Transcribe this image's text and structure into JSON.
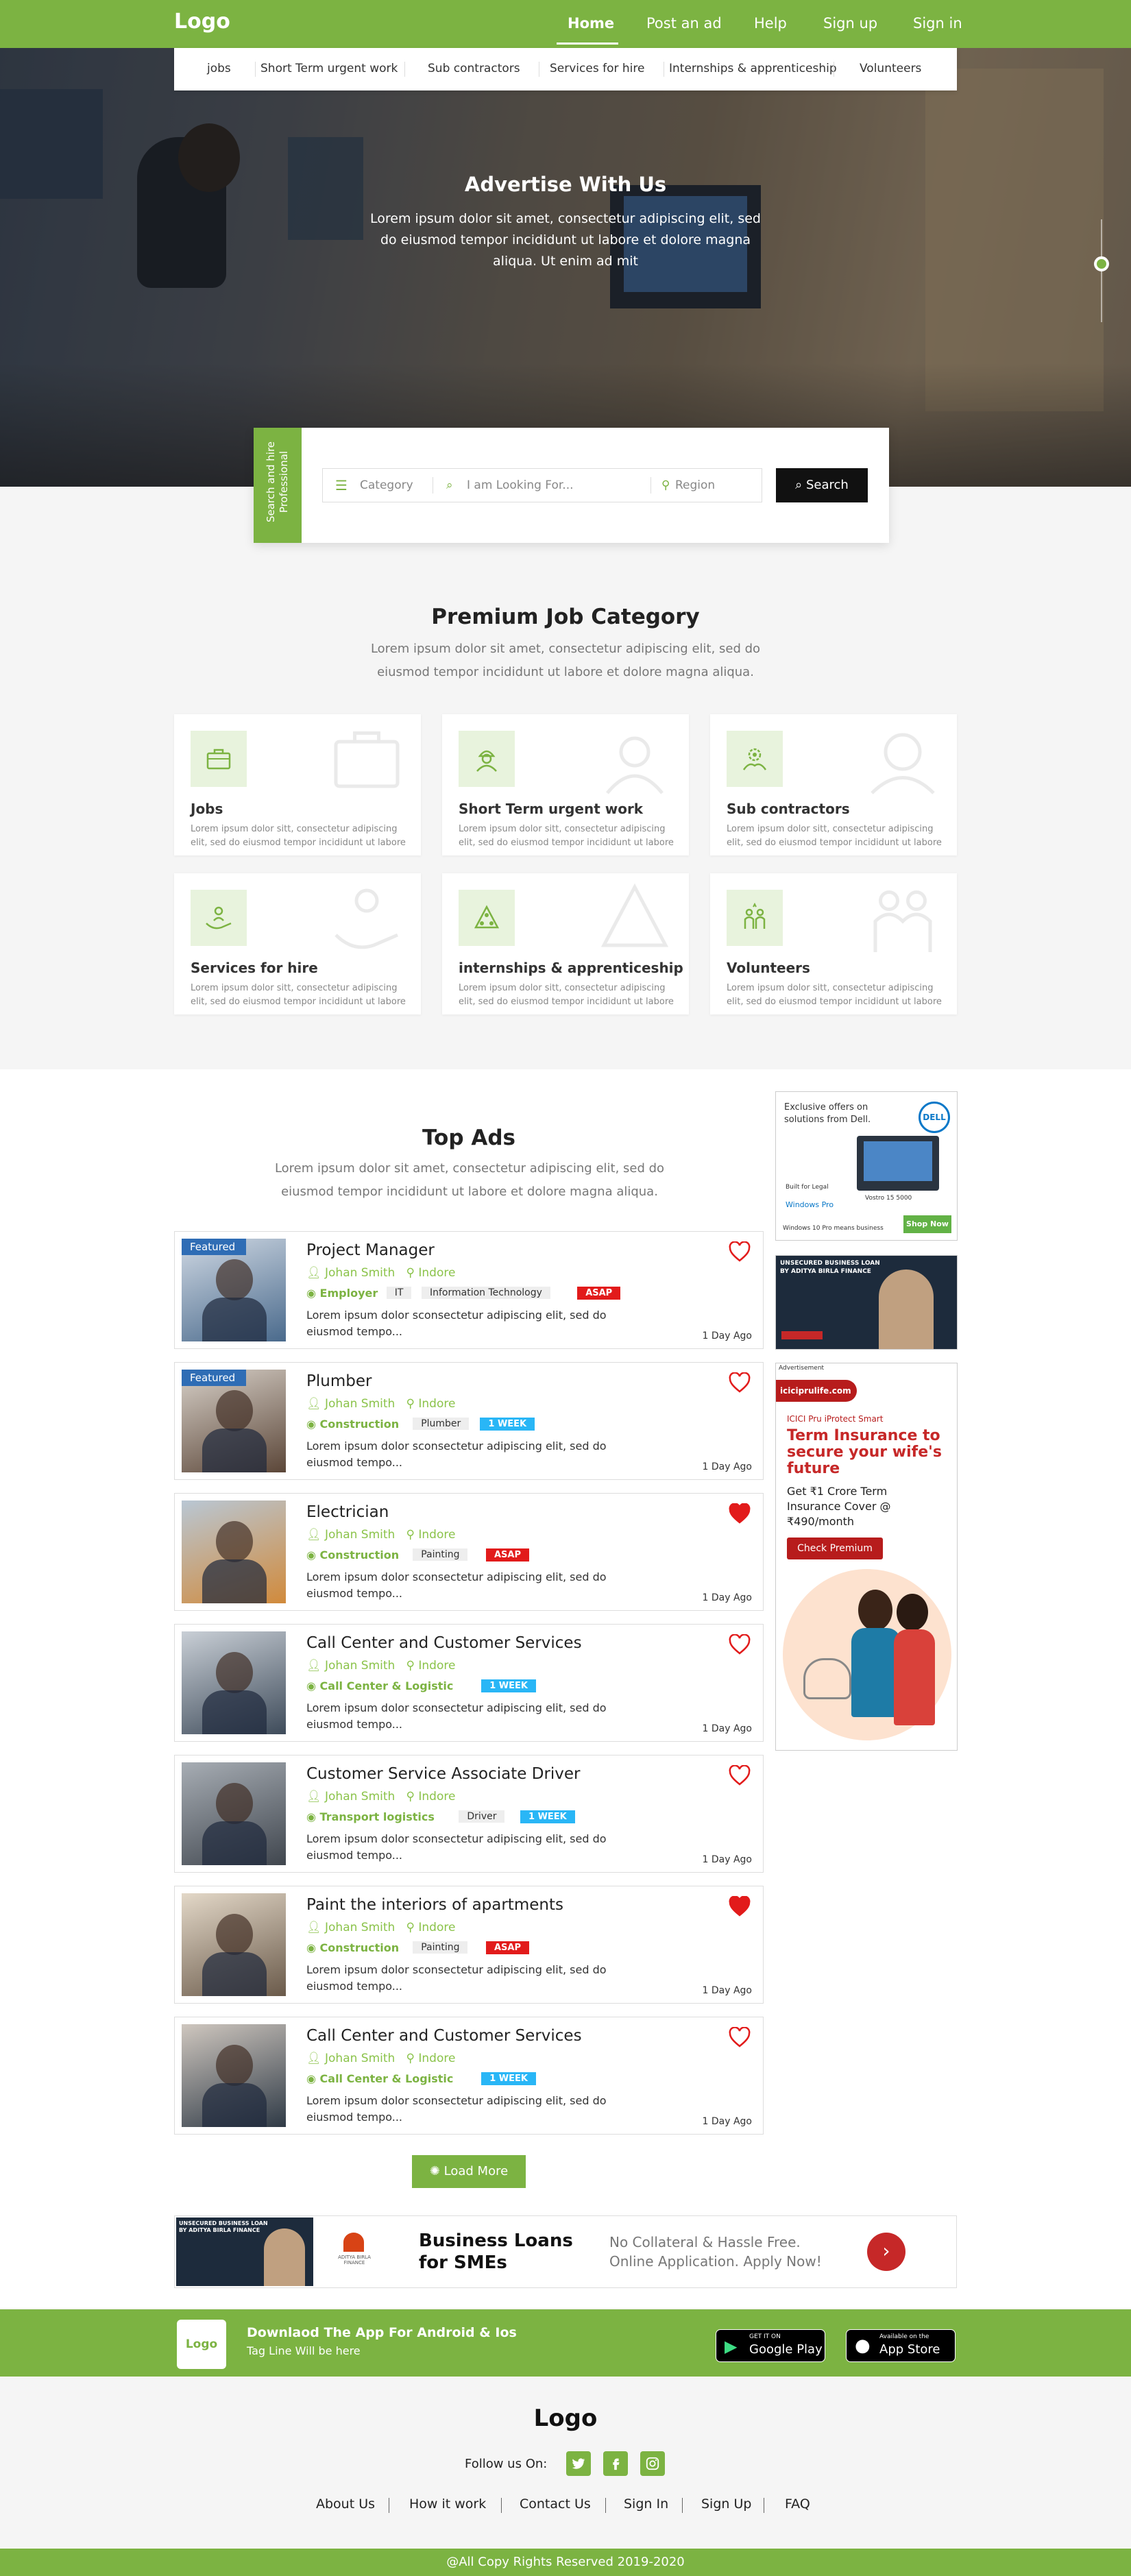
{
  "header": {
    "logo": "Logo",
    "nav": [
      "Home",
      "Post an ad",
      "Help",
      "Sign up",
      "Sign in"
    ]
  },
  "subnav": [
    "jobs",
    "Short Term urgent work",
    "Sub contractors",
    "Services for hire",
    "Internships & apprenticeship",
    "Volunteers"
  ],
  "hero": {
    "title": "Advertise With Us",
    "text": "Lorem ipsum dolor sit amet, consectetur adipiscing elit, sed do eiusmod tempor incididunt ut labore et dolore magna aliqua. Ut enim ad mit"
  },
  "search": {
    "tab_label": "Search and hire Professional",
    "category": "Category",
    "looking_placeholder": "I am Looking For...",
    "region": "Region",
    "button": "Search"
  },
  "categories": {
    "title": "Premium Job Category",
    "description": "Lorem ipsum dolor sit amet, consectetur adipiscing elit, sed do eiusmod tempor incididunt ut labore et dolore magna aliqua.",
    "items": [
      {
        "title": "Jobs",
        "text": "Lorem ipsum dolor sitt, consectetur adipiscing elit, sed do eiusmod tempor incididunt ut labore",
        "icon": "briefcase-icon"
      },
      {
        "title": "Short Term urgent work",
        "text": "Lorem ipsum dolor sitt, consectetur adipiscing elit, sed do eiusmod tempor incididunt ut labore",
        "icon": "worker-icon"
      },
      {
        "title": "Sub contractors",
        "text": "Lorem ipsum dolor sitt, consectetur adipiscing elit, sed do eiusmod tempor incididunt ut labore",
        "icon": "gear-people-icon"
      },
      {
        "title": "Services for hire",
        "text": "Lorem ipsum dolor sitt, consectetur adipiscing elit, sed do eiusmod tempor incididunt ut labore",
        "icon": "hand-person-icon"
      },
      {
        "title": "internships & apprenticeship",
        "text": "Lorem ipsum dolor sitt, consectetur adipiscing elit, sed do eiusmod tempor incididunt ut labore",
        "icon": "team-pyramid-icon"
      },
      {
        "title": "Volunteers",
        "text": "Lorem ipsum dolor sitt, consectetur adipiscing elit, sed do eiusmod tempor incididunt ut labore",
        "icon": "volunteers-icon"
      }
    ]
  },
  "top_ads": {
    "title": "Top Ads",
    "description": "Lorem ipsum dolor sit amet, consectetur adipiscing elit, sed do eiusmod tempor incididunt ut labore et dolore magna aliqua.",
    "featured_label": "Featured",
    "items": [
      {
        "title": "Project Manager",
        "user": "Johan Smith",
        "location": "Indore",
        "category": "Employer",
        "tags": [
          "IT",
          "Information Technology"
        ],
        "badge": "ASAP",
        "desc": "Lorem ipsum dolor sconsectetur adipiscing elit, sed do eiusmod tempo...",
        "time": "1 Day Ago",
        "featured": true,
        "favorited": false
      },
      {
        "title": "Plumber",
        "user": "Johan Smith",
        "location": "Indore",
        "category": "Construction",
        "tags": [
          "Plumber"
        ],
        "badge": "1 WEEK",
        "desc": "Lorem ipsum dolor sconsectetur adipiscing elit, sed do eiusmod tempo...",
        "time": "1 Day Ago",
        "featured": true,
        "favorited": false
      },
      {
        "title": "Electrician",
        "user": "Johan Smith",
        "location": "Indore",
        "category": "Construction",
        "tags": [
          "Painting"
        ],
        "badge": "ASAP",
        "desc": "Lorem ipsum dolor sconsectetur adipiscing elit, sed do eiusmod tempo...",
        "time": "1 Day Ago",
        "featured": false,
        "favorited": true
      },
      {
        "title": "Call Center and Customer Services",
        "user": "Johan Smith",
        "location": "Indore",
        "category": "Call Center & Logistic",
        "tags": [],
        "badge": "1 WEEK",
        "desc": "Lorem ipsum dolor sconsectetur adipiscing elit, sed do eiusmod tempo...",
        "time": "1 Day Ago",
        "featured": false,
        "favorited": false
      },
      {
        "title": "Customer Service Associate Driver",
        "user": "Johan Smith",
        "location": "Indore",
        "category": "Transport logistics",
        "tags": [
          "Driver"
        ],
        "badge": "1 WEEK",
        "desc": "Lorem ipsum dolor sconsectetur adipiscing elit, sed do eiusmod tempo...",
        "time": "1 Day Ago",
        "featured": false,
        "favorited": false
      },
      {
        "title": "Paint the interiors of apartments",
        "user": "Johan Smith",
        "location": "Indore",
        "category": "Construction",
        "tags": [
          "Painting"
        ],
        "badge": "ASAP",
        "desc": "Lorem ipsum dolor sconsectetur adipiscing elit, sed do eiusmod tempo...",
        "time": "1 Day Ago",
        "featured": false,
        "favorited": true
      },
      {
        "title": "Call Center and Customer Services",
        "user": "Johan Smith",
        "location": "Indore",
        "category": "Call Center & Logistic",
        "tags": [],
        "badge": "1 WEEK",
        "desc": "Lorem ipsum dolor sconsectetur adipiscing elit, sed do eiusmod tempo...",
        "time": "1 Day Ago",
        "featured": false,
        "favorited": false
      }
    ],
    "load_more": "Load More"
  },
  "side_ads": {
    "dell": {
      "headline": "Exclusive offers on solutions from Dell.",
      "brand": "DELL",
      "line1": "Built for Legal",
      "windows": "Windows Pro",
      "model": "Vostro 15 5000",
      "tagline": "Windows 10 Pro means business",
      "cta": "Shop Now"
    },
    "loan": {
      "line1": "UNSECURED BUSINESS LOAN",
      "line2": "BY ADITYA BIRLA FINANCE"
    },
    "insurance": {
      "label": "Advertisement",
      "site": "iciciprulife.com",
      "product": "ICICI Pru iProtect Smart",
      "headline": "Term Insurance to secure your wife's future",
      "body": "Get ₹1 Crore Term Insurance Cover @ ₹490/month",
      "cta": "Check Premium"
    }
  },
  "banner": {
    "loan_line1": "UNSECURED BUSINESS LOAN",
    "loan_line2": "BY ADITYA BIRLA FINANCE",
    "brand": "ADITYA BIRLA FINANCE",
    "headline": "Business Loans for SMEs",
    "text": "No Collateral & Hassle Free. Online Application. Apply Now!"
  },
  "app": {
    "logo": "Logo",
    "title": "Downlaod The App For Android & Ios",
    "tagline": "Tag Line Will be here",
    "google_small": "GET IT ON",
    "google_big": "Google Play",
    "apple_small": "Available on the",
    "apple_big": "App Store"
  },
  "footer": {
    "logo": "Logo",
    "follow": "Follow us On:",
    "links": [
      "About Us",
      "How it work",
      "Contact Us",
      "Sign In",
      "Sign Up",
      "FAQ"
    ],
    "copyright": "@All Copy Rights Reserved 2019-2020"
  },
  "colors": {
    "brand_green": "#7cb342",
    "asap_red": "#e21b1b",
    "week_blue": "#29b6f6",
    "featured_blue": "#2f6db5"
  }
}
